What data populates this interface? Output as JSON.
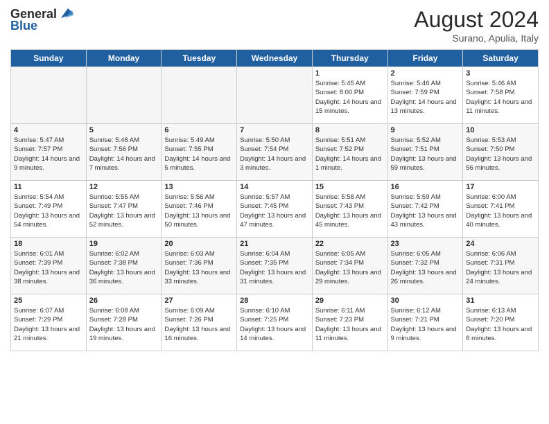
{
  "header": {
    "logo_general": "General",
    "logo_blue": "Blue",
    "title": "August 2024",
    "location": "Surano, Apulia, Italy"
  },
  "days_of_week": [
    "Sunday",
    "Monday",
    "Tuesday",
    "Wednesday",
    "Thursday",
    "Friday",
    "Saturday"
  ],
  "weeks": [
    [
      {
        "day": "",
        "empty": true
      },
      {
        "day": "",
        "empty": true
      },
      {
        "day": "",
        "empty": true
      },
      {
        "day": "",
        "empty": true
      },
      {
        "day": "1",
        "sunrise": "5:45 AM",
        "sunset": "8:00 PM",
        "daylight": "14 hours and 15 minutes."
      },
      {
        "day": "2",
        "sunrise": "5:46 AM",
        "sunset": "7:59 PM",
        "daylight": "14 hours and 13 minutes."
      },
      {
        "day": "3",
        "sunrise": "5:46 AM",
        "sunset": "7:58 PM",
        "daylight": "14 hours and 11 minutes."
      }
    ],
    [
      {
        "day": "4",
        "sunrise": "5:47 AM",
        "sunset": "7:57 PM",
        "daylight": "14 hours and 9 minutes."
      },
      {
        "day": "5",
        "sunrise": "5:48 AM",
        "sunset": "7:56 PM",
        "daylight": "14 hours and 7 minutes."
      },
      {
        "day": "6",
        "sunrise": "5:49 AM",
        "sunset": "7:55 PM",
        "daylight": "14 hours and 5 minutes."
      },
      {
        "day": "7",
        "sunrise": "5:50 AM",
        "sunset": "7:54 PM",
        "daylight": "14 hours and 3 minutes."
      },
      {
        "day": "8",
        "sunrise": "5:51 AM",
        "sunset": "7:52 PM",
        "daylight": "14 hours and 1 minute."
      },
      {
        "day": "9",
        "sunrise": "5:52 AM",
        "sunset": "7:51 PM",
        "daylight": "13 hours and 59 minutes."
      },
      {
        "day": "10",
        "sunrise": "5:53 AM",
        "sunset": "7:50 PM",
        "daylight": "13 hours and 56 minutes."
      }
    ],
    [
      {
        "day": "11",
        "sunrise": "5:54 AM",
        "sunset": "7:49 PM",
        "daylight": "13 hours and 54 minutes."
      },
      {
        "day": "12",
        "sunrise": "5:55 AM",
        "sunset": "7:47 PM",
        "daylight": "13 hours and 52 minutes."
      },
      {
        "day": "13",
        "sunrise": "5:56 AM",
        "sunset": "7:46 PM",
        "daylight": "13 hours and 50 minutes."
      },
      {
        "day": "14",
        "sunrise": "5:57 AM",
        "sunset": "7:45 PM",
        "daylight": "13 hours and 47 minutes."
      },
      {
        "day": "15",
        "sunrise": "5:58 AM",
        "sunset": "7:43 PM",
        "daylight": "13 hours and 45 minutes."
      },
      {
        "day": "16",
        "sunrise": "5:59 AM",
        "sunset": "7:42 PM",
        "daylight": "13 hours and 43 minutes."
      },
      {
        "day": "17",
        "sunrise": "6:00 AM",
        "sunset": "7:41 PM",
        "daylight": "13 hours and 40 minutes."
      }
    ],
    [
      {
        "day": "18",
        "sunrise": "6:01 AM",
        "sunset": "7:39 PM",
        "daylight": "13 hours and 38 minutes."
      },
      {
        "day": "19",
        "sunrise": "6:02 AM",
        "sunset": "7:38 PM",
        "daylight": "13 hours and 36 minutes."
      },
      {
        "day": "20",
        "sunrise": "6:03 AM",
        "sunset": "7:36 PM",
        "daylight": "13 hours and 33 minutes."
      },
      {
        "day": "21",
        "sunrise": "6:04 AM",
        "sunset": "7:35 PM",
        "daylight": "13 hours and 31 minutes."
      },
      {
        "day": "22",
        "sunrise": "6:05 AM",
        "sunset": "7:34 PM",
        "daylight": "13 hours and 29 minutes."
      },
      {
        "day": "23",
        "sunrise": "6:05 AM",
        "sunset": "7:32 PM",
        "daylight": "13 hours and 26 minutes."
      },
      {
        "day": "24",
        "sunrise": "6:06 AM",
        "sunset": "7:31 PM",
        "daylight": "13 hours and 24 minutes."
      }
    ],
    [
      {
        "day": "25",
        "sunrise": "6:07 AM",
        "sunset": "7:29 PM",
        "daylight": "13 hours and 21 minutes."
      },
      {
        "day": "26",
        "sunrise": "6:08 AM",
        "sunset": "7:28 PM",
        "daylight": "13 hours and 19 minutes."
      },
      {
        "day": "27",
        "sunrise": "6:09 AM",
        "sunset": "7:26 PM",
        "daylight": "13 hours and 16 minutes."
      },
      {
        "day": "28",
        "sunrise": "6:10 AM",
        "sunset": "7:25 PM",
        "daylight": "13 hours and 14 minutes."
      },
      {
        "day": "29",
        "sunrise": "6:11 AM",
        "sunset": "7:23 PM",
        "daylight": "13 hours and 11 minutes."
      },
      {
        "day": "30",
        "sunrise": "6:12 AM",
        "sunset": "7:21 PM",
        "daylight": "13 hours and 9 minutes."
      },
      {
        "day": "31",
        "sunrise": "6:13 AM",
        "sunset": "7:20 PM",
        "daylight": "13 hours and 6 minutes."
      }
    ]
  ]
}
